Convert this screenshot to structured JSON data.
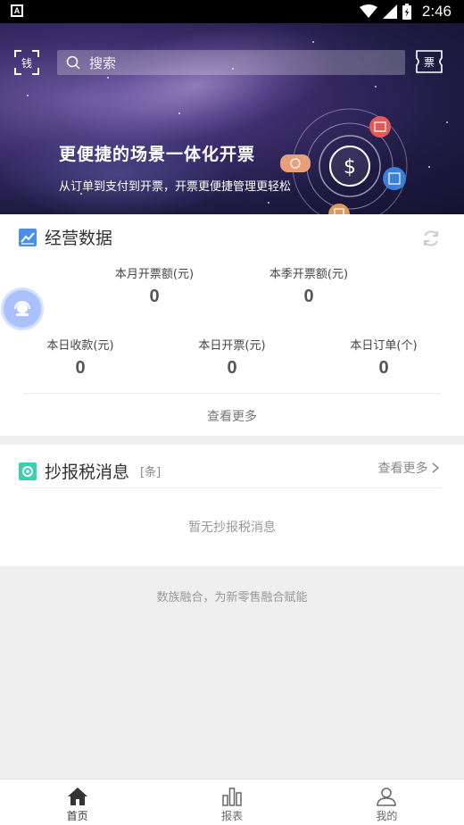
{
  "status_bar": {
    "app_badge": "A",
    "time": "2:46"
  },
  "banner": {
    "scan_label": "钱",
    "search_placeholder": "搜索",
    "ticket_label": "票",
    "title": "更便捷的场景一体化开票",
    "subtitle": "从订单到支付到开票，开票更便捷管理更轻松",
    "orbit_symbol": "$"
  },
  "business": {
    "title": "经营数据",
    "metrics": [
      {
        "label": "本月开票额(元)",
        "value": "0"
      },
      {
        "label": "本季开票额(元)",
        "value": "0"
      },
      {
        "label": "本日收款(元)",
        "value": "0"
      },
      {
        "label": "本日开票(元)",
        "value": "0"
      },
      {
        "label": "本日订单(个)",
        "value": "0"
      }
    ],
    "more": "查看更多"
  },
  "tax_messages": {
    "title": "抄报税消息",
    "unit": "[条]",
    "more": "查看更多",
    "empty": "暂无抄报税消息"
  },
  "slogan": "数族融合，为新零售融合赋能",
  "nav": [
    {
      "label": "首页",
      "icon": "home-icon"
    },
    {
      "label": "报表",
      "icon": "chart-icon"
    },
    {
      "label": "我的",
      "icon": "user-icon"
    }
  ],
  "colors": {
    "accent": "#4a8fe7",
    "teal": "#3ecfb0"
  }
}
